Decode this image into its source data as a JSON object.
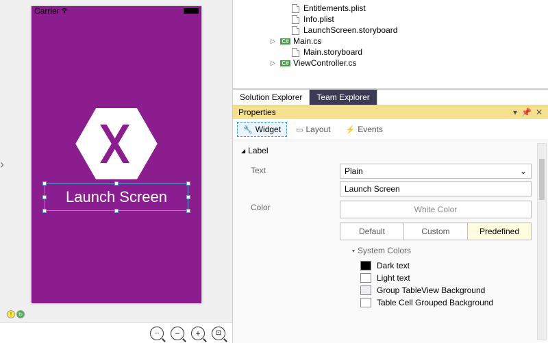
{
  "designer": {
    "statusbar_carrier": "Carrier",
    "launch_text": "Launch Screen"
  },
  "tree": {
    "files": [
      {
        "icon": "doc",
        "label": "Entitlements.plist",
        "indent": 1,
        "expand": ""
      },
      {
        "icon": "doc",
        "label": "Info.plist",
        "indent": 1,
        "expand": ""
      },
      {
        "icon": "doc",
        "label": "LaunchScreen.storyboard",
        "indent": 1,
        "expand": ""
      },
      {
        "icon": "cs",
        "label": "Main.cs",
        "indent": 0,
        "expand": "▷"
      },
      {
        "icon": "doc",
        "label": "Main.storyboard",
        "indent": 1,
        "expand": ""
      },
      {
        "icon": "cs",
        "label": "ViewController.cs",
        "indent": 0,
        "expand": "▷"
      }
    ]
  },
  "bottomTabs": {
    "solution": "Solution Explorer",
    "team": "Team Explorer"
  },
  "props": {
    "title": "Properties",
    "tabs": {
      "widget": "Widget",
      "layout": "Layout",
      "events": "Events"
    },
    "section": "Label",
    "text_label": "Text",
    "text_type": "Plain",
    "text_value": "Launch Screen",
    "color_label": "Color",
    "color_value": "White Color",
    "color_tabs": {
      "default": "Default",
      "custom": "Custom",
      "predefined": "Predefined"
    },
    "sys_colors_section": "System Colors",
    "sys_colors": [
      {
        "name": "Dark text",
        "swatch": "#000000"
      },
      {
        "name": "Light text",
        "swatch": "#ffffff"
      },
      {
        "name": "Group TableView Background",
        "swatch": "#efeff4"
      },
      {
        "name": "Table Cell Grouped Background",
        "swatch": "#ffffff"
      }
    ]
  }
}
